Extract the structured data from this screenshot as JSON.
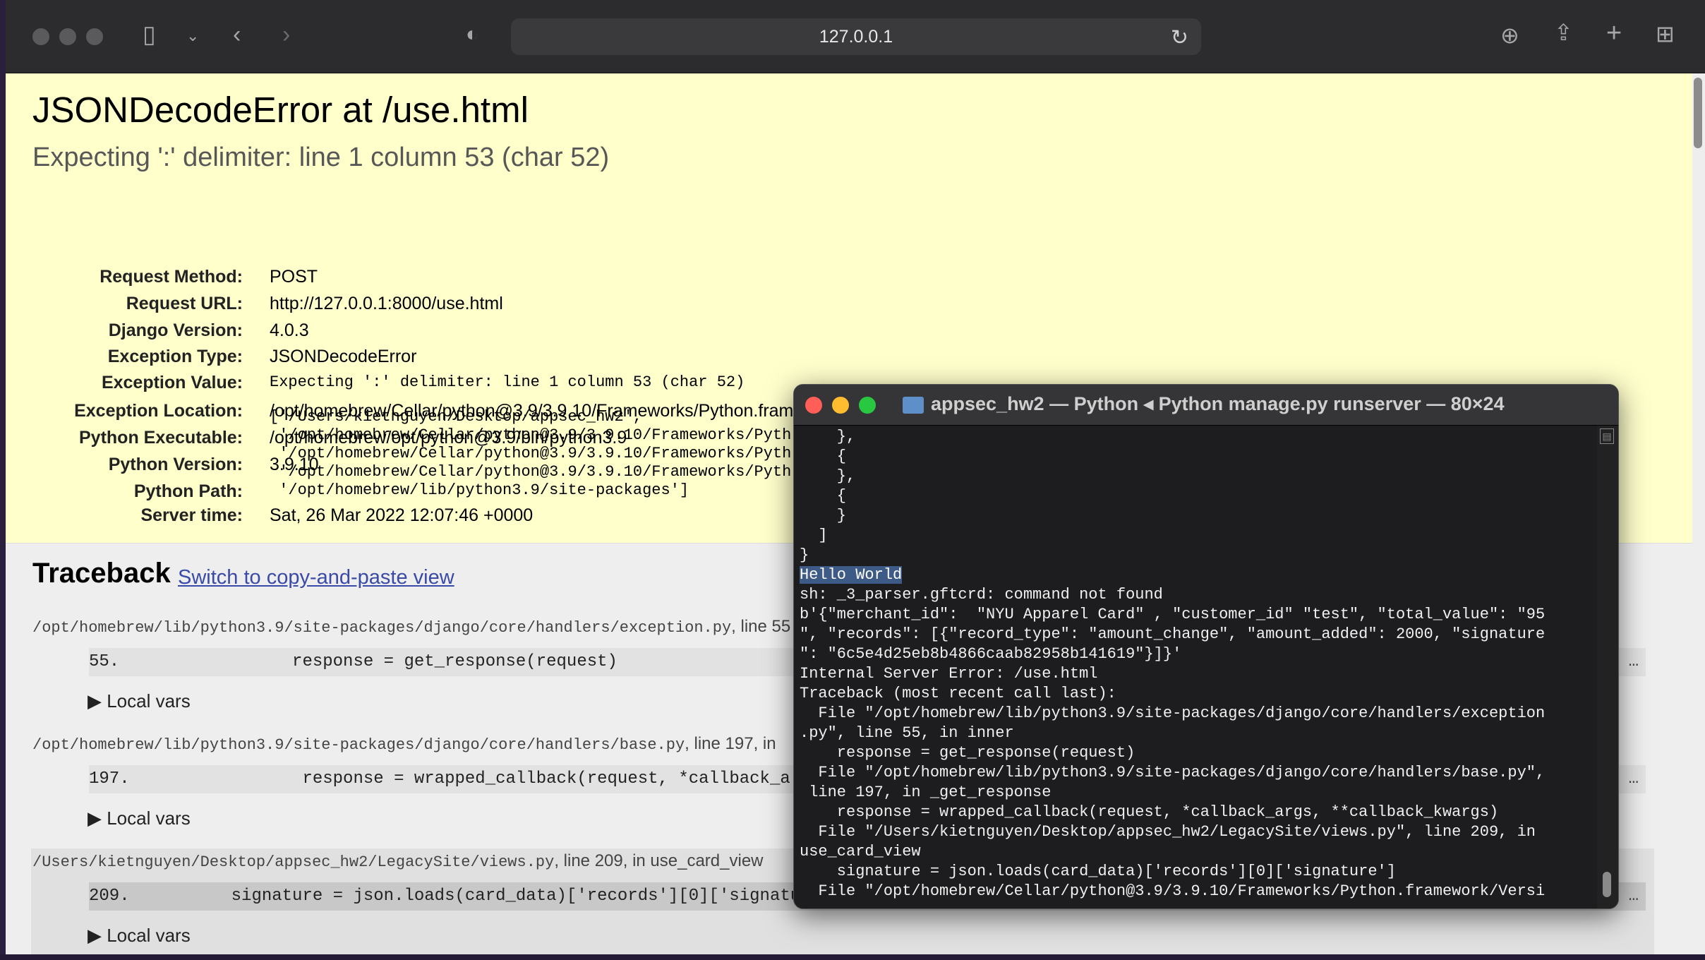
{
  "browser": {
    "url": "127.0.0.1"
  },
  "page": {
    "title": "JSONDecodeError at /use.html",
    "subtitle": "Expecting ':' delimiter: line 1 column 53 (char 52)",
    "meta": [
      {
        "key": "Request Method:",
        "value": "POST",
        "mono": false
      },
      {
        "key": "Request URL:",
        "value": "http://127.0.0.1:8000/use.html",
        "mono": false
      },
      {
        "key": "Django Version:",
        "value": "4.0.3",
        "mono": false
      },
      {
        "key": "Exception Type:",
        "value": "JSONDecodeError",
        "mono": false
      },
      {
        "key": "Exception Value:",
        "value": "Expecting ':' delimiter: line 1 column 53 (char 52)",
        "mono": true
      },
      {
        "key": "Exception Location:",
        "value": "/opt/homebrew/Cellar/python@3.9/3.9.10/Frameworks/Python.framework/Versions/3.9/lib/python3.9/json/decoder.py, line 353, in raw_decode",
        "mono": false
      },
      {
        "key": "Python Executable:",
        "value": "/opt/homebrew/opt/python@3.9/bin/python3.9",
        "mono": false
      },
      {
        "key": "Python Version:",
        "value": "3.9.10",
        "mono": false
      },
      {
        "key": "Python Path:",
        "value": "",
        "mono": false
      }
    ],
    "python_path": "['/Users/kietnguyen/Desktop/appsec_hw2',\n '/opt/homebrew/Cellar/python@3.9/3.9.10/Frameworks/Pyth\n '/opt/homebrew/Cellar/python@3.9/3.9.10/Frameworks/Pyth\n '/opt/homebrew/Cellar/python@3.9/3.9.10/Frameworks/Pyth\n '/opt/homebrew/lib/python3.9/site-packages']",
    "server_time_key": "Server time:",
    "server_time": "Sat, 26 Mar 2022 12:07:46 +0000",
    "traceback_title": "Traceback",
    "traceback_link": "Switch to copy-and-paste view",
    "frames": [
      {
        "path": "/opt/homebrew/lib/python3.9/site-packages/django/core/handlers/exception.py",
        "suffix": ", line 55",
        "code": "55.                 response = get_response(request)",
        "locals": "Local vars"
      },
      {
        "path": "/opt/homebrew/lib/python3.9/site-packages/django/core/handlers/base.py",
        "suffix": ", line 197, in",
        "code": "197.                 response = wrapped_callback(request, *callback_a",
        "locals": "Local vars"
      },
      {
        "path": "/Users/kietnguyen/Desktop/appsec_hw2/LegacySite/views.py",
        "suffix": ", line 209, in use_card_view",
        "code": "209.          signature = json.loads(card_data)['records'][0]['signatu",
        "locals": "Local vars"
      }
    ],
    "ellipsis": "…"
  },
  "terminal": {
    "title": "appsec_hw2 — Python ◂ Python manage.py runserver — 80×24",
    "lines_before": "    },\n    {\n    },\n    {\n    }\n  ]\n}",
    "selected_line": "Hello World",
    "lines_after": "sh: _3_parser.gftcrd: command not found\nb'{\"merchant_id\":  \"NYU Apparel Card\" , \"customer_id\" \"test\", \"total_value\": \"95\n\", \"records\": [{\"record_type\": \"amount_change\", \"amount_added\": 2000, \"signature\n\": \"6c5e4d25eb8b4866caab82958b141619\"}]}'\nInternal Server Error: /use.html\nTraceback (most recent call last):\n  File \"/opt/homebrew/lib/python3.9/site-packages/django/core/handlers/exception\n.py\", line 55, in inner\n    response = get_response(request)\n  File \"/opt/homebrew/lib/python3.9/site-packages/django/core/handlers/base.py\",\n line 197, in _get_response\n    response = wrapped_callback(request, *callback_args, **callback_kwargs)\n  File \"/Users/kietnguyen/Desktop/appsec_hw2/LegacySite/views.py\", line 209, in\nuse_card_view\n    signature = json.loads(card_data)['records'][0]['signature']\n  File \"/opt/homebrew/Cellar/python@3.9/3.9.10/Frameworks/Python.framework/Versi"
  },
  "colors": {
    "summary_bg": "#ffffcc",
    "toolbar_bg": "#2c2c2e",
    "terminal_bg": "#1d1d1f",
    "close": "#ff5f57",
    "minimize": "#febc2e",
    "zoom": "#28c840"
  }
}
